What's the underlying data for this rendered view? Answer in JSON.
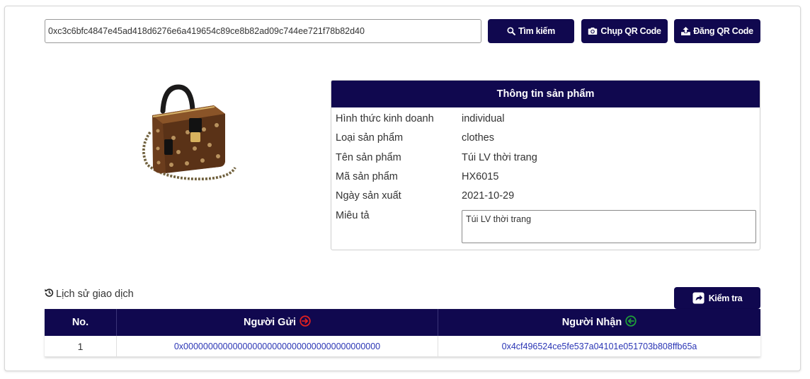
{
  "search": {
    "value": "0xc3c6bfc4847e45ad418d6276e6a419654c89ce8b82ad09c744ee721f78b82d40",
    "search_label": "Tìm kiếm",
    "camera_label": "Chụp QR Code",
    "upload_label": "Đăng QR Code"
  },
  "product": {
    "panel_title": "Thông tin sản phẩm",
    "rows": [
      {
        "label": "Hình thức kinh doanh",
        "value": "individual"
      },
      {
        "label": "Loại sản phẩm",
        "value": "clothes"
      },
      {
        "label": "Tên sản phẩm",
        "value": "Túi LV thời trang"
      },
      {
        "label": "Mã sản phẩm",
        "value": "HX6015"
      },
      {
        "label": "Ngày sản xuất",
        "value": "2021-10-29"
      }
    ],
    "description_label": "Miêu tả",
    "description": "Túi LV thời trang"
  },
  "history": {
    "title": "Lịch sử giao dịch",
    "check_label": "Kiểm tra",
    "columns": {
      "no": "No.",
      "sender": "Người Gửi",
      "receiver": "Người Nhận"
    },
    "rows": [
      {
        "no": "1",
        "sender": "0x0000000000000000000000000000000000000000",
        "receiver": "0x4cf496524ce5fe537a04101e051703b808ffb65a"
      }
    ]
  },
  "colors": {
    "primary": "#10084f",
    "link": "#2a35b5",
    "sender_icon": "#e02020",
    "receiver_icon": "#1f9d3a"
  },
  "icons": {
    "search": "search-icon",
    "camera": "camera-icon",
    "upload": "upload-icon",
    "history": "history-icon",
    "check": "share-square-icon",
    "sender": "arrow-circle-right-icon",
    "receiver": "arrow-circle-left-icon"
  }
}
